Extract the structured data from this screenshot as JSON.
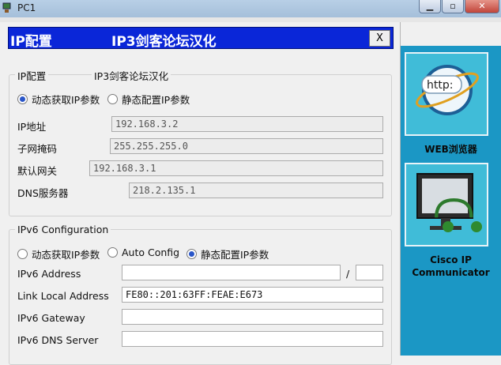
{
  "window": {
    "title": "PC1",
    "minimize_icon": "minimize-icon",
    "maximize_icon": "maximize-icon",
    "close_icon": "close-icon"
  },
  "dialog": {
    "title": "IP配置",
    "subtitle": "IP3剑客论坛汉化",
    "close_label": "X",
    "ipv4": {
      "legend": "IP配置",
      "legend_sub": "IP3剑客论坛汉化",
      "dhcp_label": "动态获取IP参数",
      "static_label": "静态配置IP参数",
      "mode": "dhcp",
      "ip_label": "IP地址",
      "ip_value": "192.168.3.2",
      "mask_label": "子网掩码",
      "mask_value": "255.255.255.0",
      "gateway_label": "默认网关",
      "gateway_value": "192.168.3.1",
      "dns_label": "DNS服务器",
      "dns_value": "218.2.135.1"
    },
    "ipv6": {
      "legend": "IPv6 Configuration",
      "dhcp_label": "动态获取IP参数",
      "auto_label": "Auto Config",
      "static_label": "静态配置IP参数",
      "mode": "static",
      "address_label": "IPv6 Address",
      "address_value": "",
      "prefix_sep": "/",
      "prefix_value": "",
      "link_local_label": "Link Local Address",
      "link_local_value": "FE80::201:63FF:FEAE:E673",
      "gateway_label": "IPv6 Gateway",
      "gateway_value": "",
      "dns_label": "IPv6 DNS Server",
      "dns_value": ""
    }
  },
  "sidebar": {
    "web_label": "WEB浏览器",
    "web_icon_text": "http:",
    "comm_label_1": "Cisco IP",
    "comm_label_2": "Communicator"
  }
}
